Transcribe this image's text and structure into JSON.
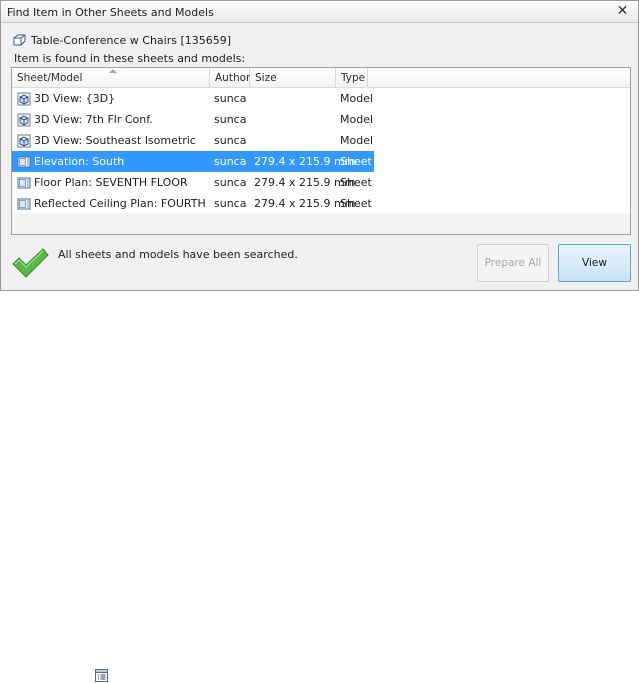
{
  "dialog": {
    "title": "Find Item in Other Sheets and Models",
    "close_glyph": "✕",
    "element_name": "Table-Conference w Chairs [135659]",
    "found_label": "Item is found in these sheets and models:"
  },
  "table": {
    "columns": {
      "name": "Sheet/Model",
      "author": "Author",
      "size": "Size",
      "type": "Type"
    },
    "rows": [
      {
        "icon": "3d-view-icon",
        "name": "3D View: {3D}",
        "author": "sunca",
        "size": "",
        "type": "Model",
        "selected": false
      },
      {
        "icon": "3d-view-icon",
        "name": "3D View: 7th Flr Conf.",
        "author": "sunca",
        "size": "",
        "type": "Model",
        "selected": false
      },
      {
        "icon": "3d-view-icon",
        "name": "3D View: Southeast Isometric",
        "author": "sunca",
        "size": "",
        "type": "Model",
        "selected": false
      },
      {
        "icon": "sheet-icon",
        "name": "Elevation: South",
        "author": "sunca",
        "size": "279.4 x 215.9 mm",
        "type": "Sheet",
        "selected": true
      },
      {
        "icon": "sheet-icon",
        "name": "Floor Plan: SEVENTH FLOOR",
        "author": "sunca",
        "size": "279.4 x 215.9 mm",
        "type": "Sheet",
        "selected": false
      },
      {
        "icon": "sheet-icon",
        "name": "Reflected Ceiling Plan: FOURTH FLOOR",
        "author": "sunca",
        "size": "279.4 x 215.9 mm",
        "type": "Sheet",
        "selected": false
      }
    ]
  },
  "status": {
    "message": "All sheets and models have been searched.",
    "icon": "checkmark-icon"
  },
  "buttons": {
    "prepare_all": "Prepare All",
    "view": "View"
  },
  "colors": {
    "selection": "#3399ff",
    "check_green": "#4caf3a",
    "view_button_border": "#5ea6d6"
  }
}
